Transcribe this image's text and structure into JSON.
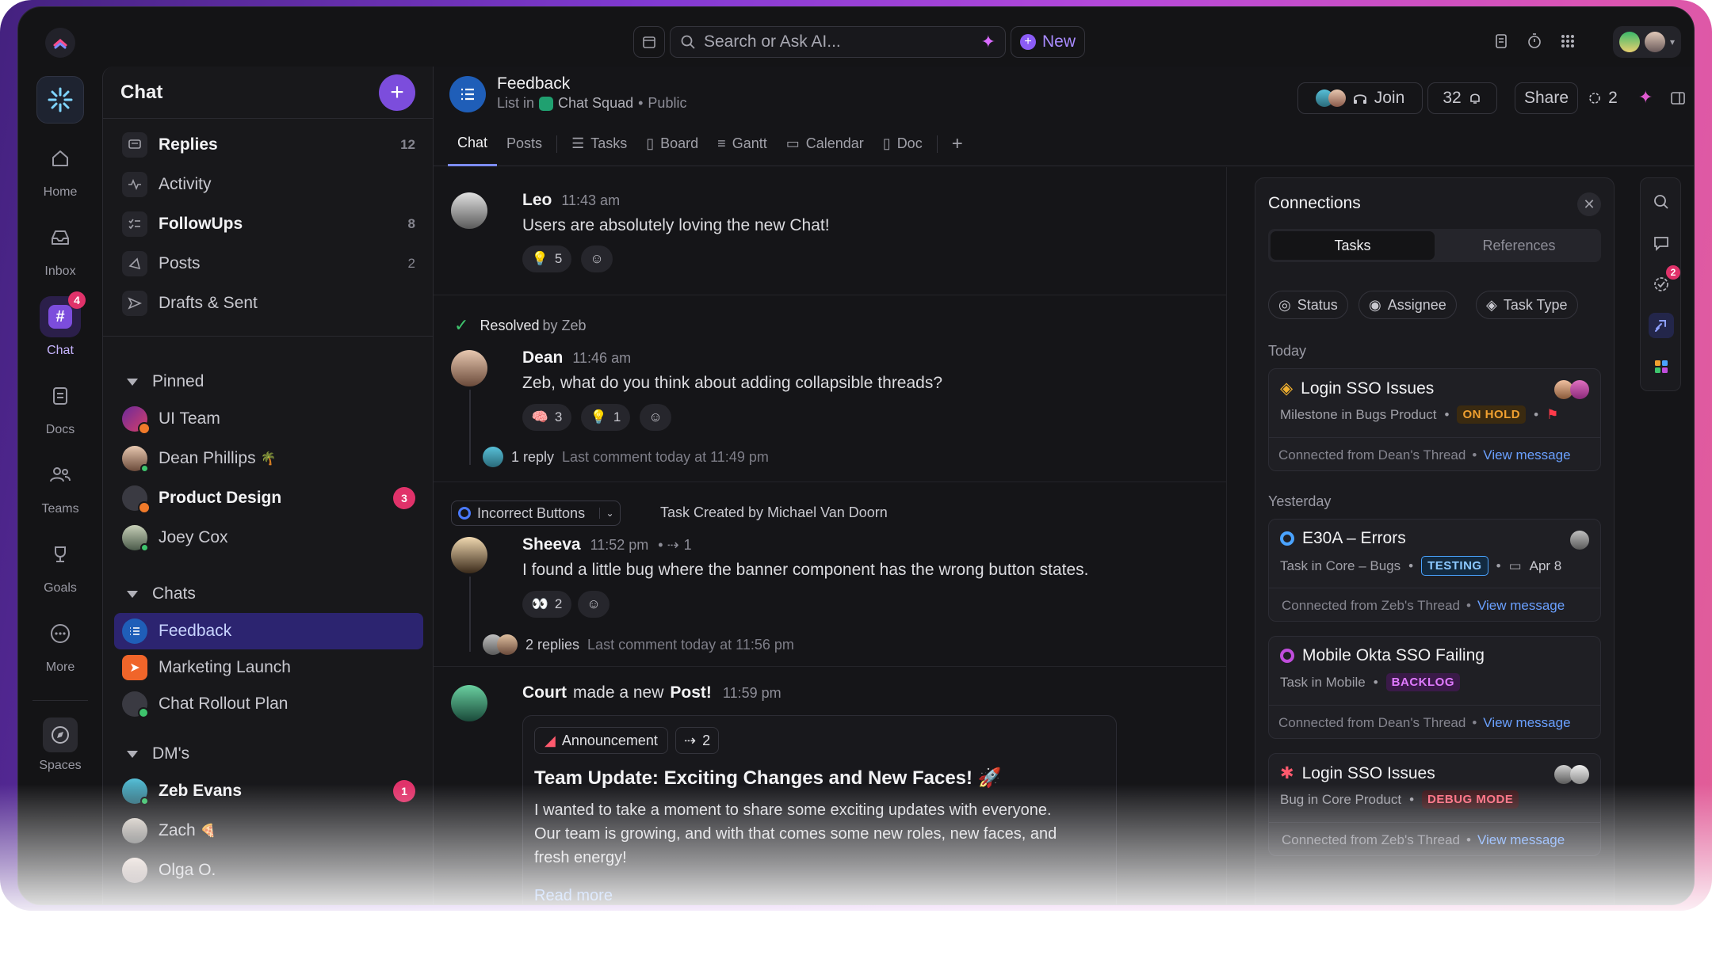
{
  "topbar": {
    "search_placeholder": "Search or Ask AI...",
    "new_label": "New"
  },
  "rail": {
    "items": [
      {
        "label": "Home"
      },
      {
        "label": "Inbox"
      },
      {
        "label": "Chat",
        "badge": "4"
      },
      {
        "label": "Docs"
      },
      {
        "label": "Teams"
      },
      {
        "label": "Goals"
      },
      {
        "label": "More"
      },
      {
        "label": "Spaces"
      }
    ]
  },
  "sidebar": {
    "title": "Chat",
    "top_items": [
      {
        "label": "Replies",
        "count": "12"
      },
      {
        "label": "Activity",
        "count": ""
      },
      {
        "label": "FollowUps",
        "count": "8"
      },
      {
        "label": "Posts",
        "count": "2"
      },
      {
        "label": "Drafts & Sent",
        "count": ""
      }
    ],
    "pinned_label": "Pinned",
    "pinned": [
      {
        "label": "UI Team"
      },
      {
        "label": "Dean Phillips",
        "emoji": "🌴"
      },
      {
        "label": "Product Design",
        "badge": "3"
      },
      {
        "label": "Joey Cox"
      }
    ],
    "chats_label": "Chats",
    "chats": [
      {
        "label": "Feedback"
      },
      {
        "label": "Marketing Launch"
      },
      {
        "label": "Chat Rollout Plan"
      }
    ],
    "dms_label": "DM's",
    "dms": [
      {
        "label": "Zeb Evans",
        "badge": "1"
      },
      {
        "label": "Zach",
        "emoji": "🍕"
      },
      {
        "label": "Olga O."
      }
    ]
  },
  "header": {
    "title": "Feedback",
    "sub_prefix": "List in",
    "space": "Chat Squad",
    "visibility": "Public",
    "join_label": "Join",
    "count": "32",
    "share_label": "Share",
    "ai_count": "2"
  },
  "tabs": [
    "Chat",
    "Posts",
    "Tasks",
    "Board",
    "Gantt",
    "Calendar",
    "Doc"
  ],
  "messages": {
    "leo": {
      "name": "Leo",
      "time": "11:43 am",
      "text": "Users are absolutely loving the new Chat!",
      "reaction_count": "5"
    },
    "resolved": {
      "label": "Resolved",
      "by": "by Zeb"
    },
    "dean": {
      "name": "Dean",
      "time": "11:46 am",
      "text": "Zeb, what do you think about adding collapsible threads?",
      "r1": "3",
      "r2": "1",
      "reply_count": "1 reply",
      "reply_meta": "Last comment today at 11:49 pm"
    },
    "task": {
      "chip": "Incorrect Buttons",
      "created": "Task Created by Michael Van Doorn"
    },
    "sheeva": {
      "name": "Sheeva",
      "time": "11:52 pm",
      "links": "1",
      "text": "I found a little bug where the banner component has the wrong button states.",
      "r1": "2",
      "reply_count": "2 replies",
      "reply_meta": "Last comment today at 11:56 pm"
    },
    "court": {
      "name": "Court",
      "mid": "made a new",
      "post": "Post!",
      "time": "11:59 pm",
      "tag": "Announcement",
      "links": "2",
      "title": "Team Update: Exciting Changes and New Faces! 🚀",
      "body1": "I wanted to take a moment to share some exciting updates with everyone.",
      "body2": "Our team is growing, and with that comes some new roles, new faces, and",
      "body3": "fresh energy!",
      "read_more": "Read more"
    }
  },
  "connections": {
    "title": "Connections",
    "seg": [
      "Tasks",
      "References"
    ],
    "filters": [
      "Status",
      "Assignee",
      "Task Type"
    ],
    "today": "Today",
    "yesterday": "Yesterday",
    "view": "View message",
    "cards": [
      {
        "title": "Login SSO Issues",
        "sub": "Milestone in Bugs Product",
        "tag": "ON HOLD",
        "tag_color": "#f0a030",
        "from": "Connected from Dean's Thread"
      },
      {
        "title": "E30A – Errors",
        "sub": "Task in Core – Bugs",
        "tag": "TESTING",
        "tag_color": "#4aa3ff",
        "date": "Apr 8",
        "from": "Connected from Zeb's Thread"
      },
      {
        "title": "Mobile Okta SSO Failing",
        "sub": "Task in Mobile",
        "tag": "BACKLOG",
        "tag_color": "#c04ddc",
        "from": "Connected from Dean's Thread"
      },
      {
        "title": "Login SSO Issues",
        "sub": "Bug in Core Product",
        "tag": "DEBUG MODE",
        "tag_color": "#ff5a6e",
        "from": "Connected from Zeb's Thread"
      }
    ]
  },
  "right_rail": {
    "badge": "2"
  },
  "colors": {
    "accent": "#7c4ddc",
    "active_row": "#2c2470",
    "badge": "#e0326a"
  }
}
